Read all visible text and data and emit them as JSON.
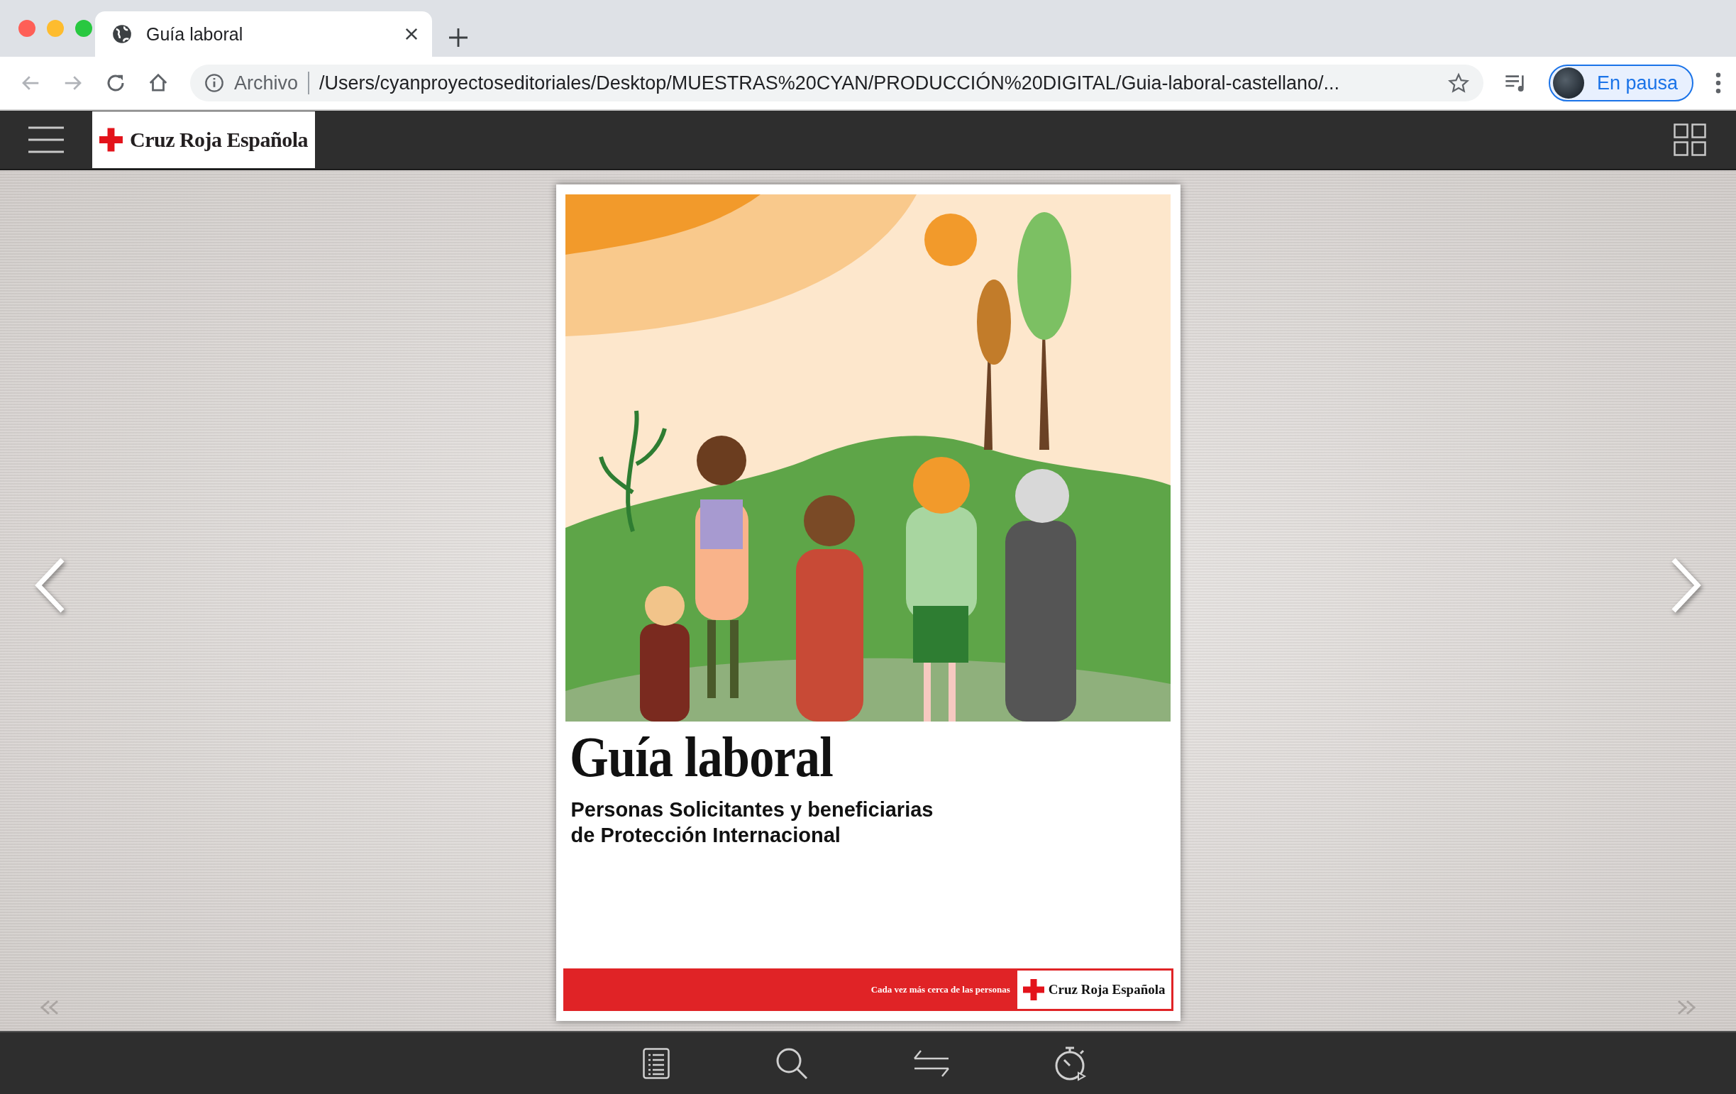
{
  "browser": {
    "tab": {
      "title": "Guía laboral",
      "selected": true
    },
    "address": {
      "scheme_label": "Archivo",
      "url": "/Users/cyanproyectoseditoriales/Desktop/MUESTRAS%20CYAN/PRODUCCIÓN%20DIGITAL/Guia-laboral-castellano/..."
    },
    "profile": {
      "label": "En pausa"
    }
  },
  "app_header": {
    "logo_text": "Cruz Roja Española"
  },
  "cover": {
    "title": "Guía laboral",
    "subtitle_lines": [
      "Personas Solicitantes y beneficiarias",
      "de Protección Internacional"
    ],
    "footer": {
      "tagline": "Cada vez más cerca de las personas",
      "logo_text": "Cruz Roja Española"
    }
  }
}
